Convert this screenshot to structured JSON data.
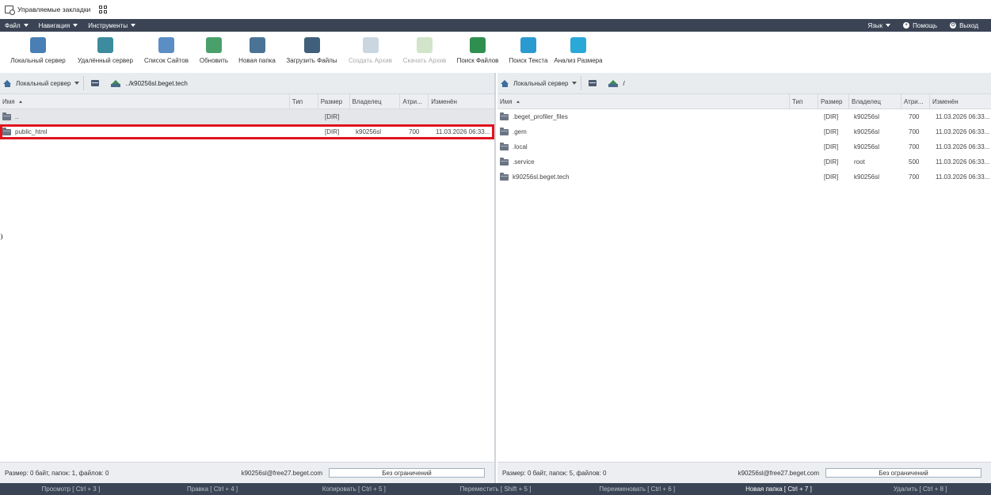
{
  "bookmarks": {
    "label": "Управляемые закладки"
  },
  "menu": {
    "items": [
      "Файл",
      "Навигация",
      "Инструменты"
    ],
    "right": {
      "language": "Язык",
      "help": "Помощь",
      "logout": "Выход"
    }
  },
  "toolbar": {
    "buttons": [
      {
        "label": "Локальный сервер",
        "icon": "home-server-icon",
        "color": "#4a7fb5"
      },
      {
        "label": "Удалённый сервер",
        "icon": "remote-server-icon",
        "color": "#3d8b9e"
      },
      {
        "label": "Список Сайтов",
        "icon": "site-list-icon",
        "color": "#5a8ec5"
      },
      {
        "label": "Обновить",
        "icon": "refresh-icon",
        "color": "#4aa06a"
      },
      {
        "label": "Новая папка",
        "icon": "new-folder-icon",
        "color": "#4a7396"
      },
      {
        "label": "Загрузить Файлы",
        "icon": "upload-icon",
        "color": "#3f5f7a"
      },
      {
        "label": "Создать Архив",
        "icon": "archive-icon",
        "color": "#7b9cb5",
        "disabled": true
      },
      {
        "label": "Скачать Архив",
        "icon": "download-archive-icon",
        "color": "#8fbf7a",
        "disabled": true
      },
      {
        "label": "Поиск Файлов",
        "icon": "search-files-icon",
        "color": "#2e8f4f"
      },
      {
        "label": "Поиск Текста",
        "icon": "search-text-icon",
        "color": "#2a9ad0"
      },
      {
        "label": "Анализ Размера",
        "icon": "size-analysis-icon",
        "color": "#2aa8d8"
      }
    ]
  },
  "columns": {
    "name": "Имя",
    "type": "Тип",
    "size": "Размер",
    "owner": "Владелец",
    "attrs": "Атри...",
    "modified": "Изменён"
  },
  "left_panel": {
    "server": "Локальный сервер",
    "path": "../k90256sl.beget.tech",
    "rows": [
      {
        "name": "..",
        "size": "[DIR]",
        "owner": "",
        "attrs": "",
        "modified": ""
      },
      {
        "name": "public_html",
        "size": "[DIR]",
        "owner": "k90256sl",
        "attrs": "700",
        "modified": "11.03.2026 06:33..."
      }
    ],
    "status": "Размер: 0 байт, папок: 1, файлов: 0",
    "user": "k90256sl@free27.beget.com",
    "limit": "Без ограничений"
  },
  "right_panel": {
    "server": "Локальный сервер",
    "path": "/",
    "rows": [
      {
        "name": ".beget_profiler_files",
        "size": "[DIR]",
        "owner": "k90256sl",
        "attrs": "700",
        "modified": "11.03.2026 06:33..."
      },
      {
        "name": ".gem",
        "size": "[DIR]",
        "owner": "k90256sl",
        "attrs": "700",
        "modified": "11.03.2026 06:33..."
      },
      {
        "name": ".local",
        "size": "[DIR]",
        "owner": "k90256sl",
        "attrs": "700",
        "modified": "11.03.2026 06:33..."
      },
      {
        "name": ".service",
        "size": "[DIR]",
        "owner": "root",
        "attrs": "500",
        "modified": "11.03.2026 06:33..."
      },
      {
        "name": "k90256sl.beget.tech",
        "size": "[DIR]",
        "owner": "k90256sl",
        "attrs": "700",
        "modified": "11.03.2026 06:33..."
      }
    ],
    "status": "Размер: 0 байт, папок: 5, файлов: 0",
    "user": "k90256sl@free27.beget.com",
    "limit": "Без ограничений"
  },
  "function_bar": [
    {
      "label": "Просмотр [ Ctrl + 3 ]"
    },
    {
      "label": "Правка [ Ctrl + 4 ]"
    },
    {
      "label": "Копировать [ Ctrl + 5 ]"
    },
    {
      "label": "Переместить [ Shift + 5 ]"
    },
    {
      "label": "Переименовать [ Ctrl + 6 ]"
    },
    {
      "label": "Новая папка [ Ctrl + 7 ]",
      "active": true
    },
    {
      "label": "Удалить [ Ctrl + 8 ]"
    }
  ]
}
